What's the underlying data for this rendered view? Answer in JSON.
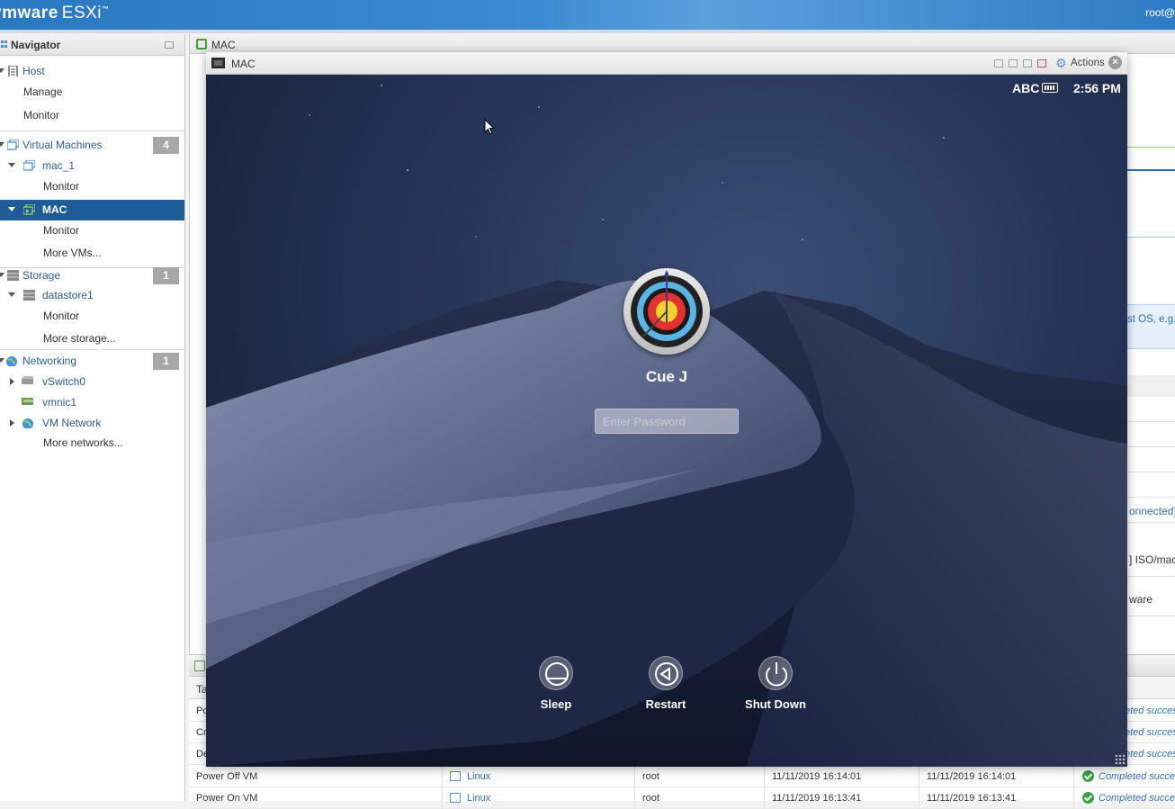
{
  "topbar": {
    "logo_vm": "vmware",
    "logo_product": "ESXi",
    "logo_tm": "™",
    "user": "root@"
  },
  "navigator": {
    "title": "Navigator",
    "host": {
      "label": "Host",
      "children": [
        "Manage",
        "Monitor"
      ]
    },
    "virtual_machines": {
      "label": "Virtual Machines",
      "count": "4"
    },
    "vm_mac1": {
      "label": "mac_1",
      "monitor": "Monitor"
    },
    "vm_mac": {
      "label": "MAC",
      "monitor": "Monitor",
      "more": "More VMs..."
    },
    "storage": {
      "label": "Storage",
      "count": "1"
    },
    "datastore": {
      "label": "datastore1",
      "monitor": "Monitor",
      "more": "More storage..."
    },
    "networking": {
      "label": "Networking",
      "count": "1"
    },
    "vswitch": "vSwitch0",
    "vmnic": "vmnic1",
    "vm_network": "VM Network",
    "more_networks": "More networks..."
  },
  "main": {
    "title": "MAC",
    "right_note": "st OS, e.g.",
    "right_rows": [
      "onnected)",
      "] ISO/mac",
      "ware"
    ]
  },
  "tasks": {
    "col_first": "Ta",
    "partial_rows": [
      "Po",
      "Cr",
      "De"
    ],
    "partial_status": "eted succes",
    "rows": [
      {
        "task": "Power Off VM",
        "target": "Linux",
        "initiator": "root",
        "queued": "11/11/2019 16:14:01",
        "started": "11/11/2019 16:14:01",
        "result": "Completed succes"
      },
      {
        "task": "Power On VM",
        "target": "Linux",
        "initiator": "root",
        "queued": "11/11/2019 16:13:41",
        "started": "11/11/2019 16:13:41",
        "result": "Completed succes"
      }
    ]
  },
  "console": {
    "title": "MAC",
    "actions": "Actions",
    "menubar": {
      "input": "ABC",
      "time": "2:56 PM"
    },
    "user_name": "Cue J",
    "password_placeholder": "Enter Password",
    "buttons": {
      "sleep": "Sleep",
      "restart": "Restart",
      "shutdown": "Shut Down"
    }
  },
  "colors": {
    "accent": "#1e5c98",
    "link": "#2f72b8",
    "success": "#3aa141"
  }
}
